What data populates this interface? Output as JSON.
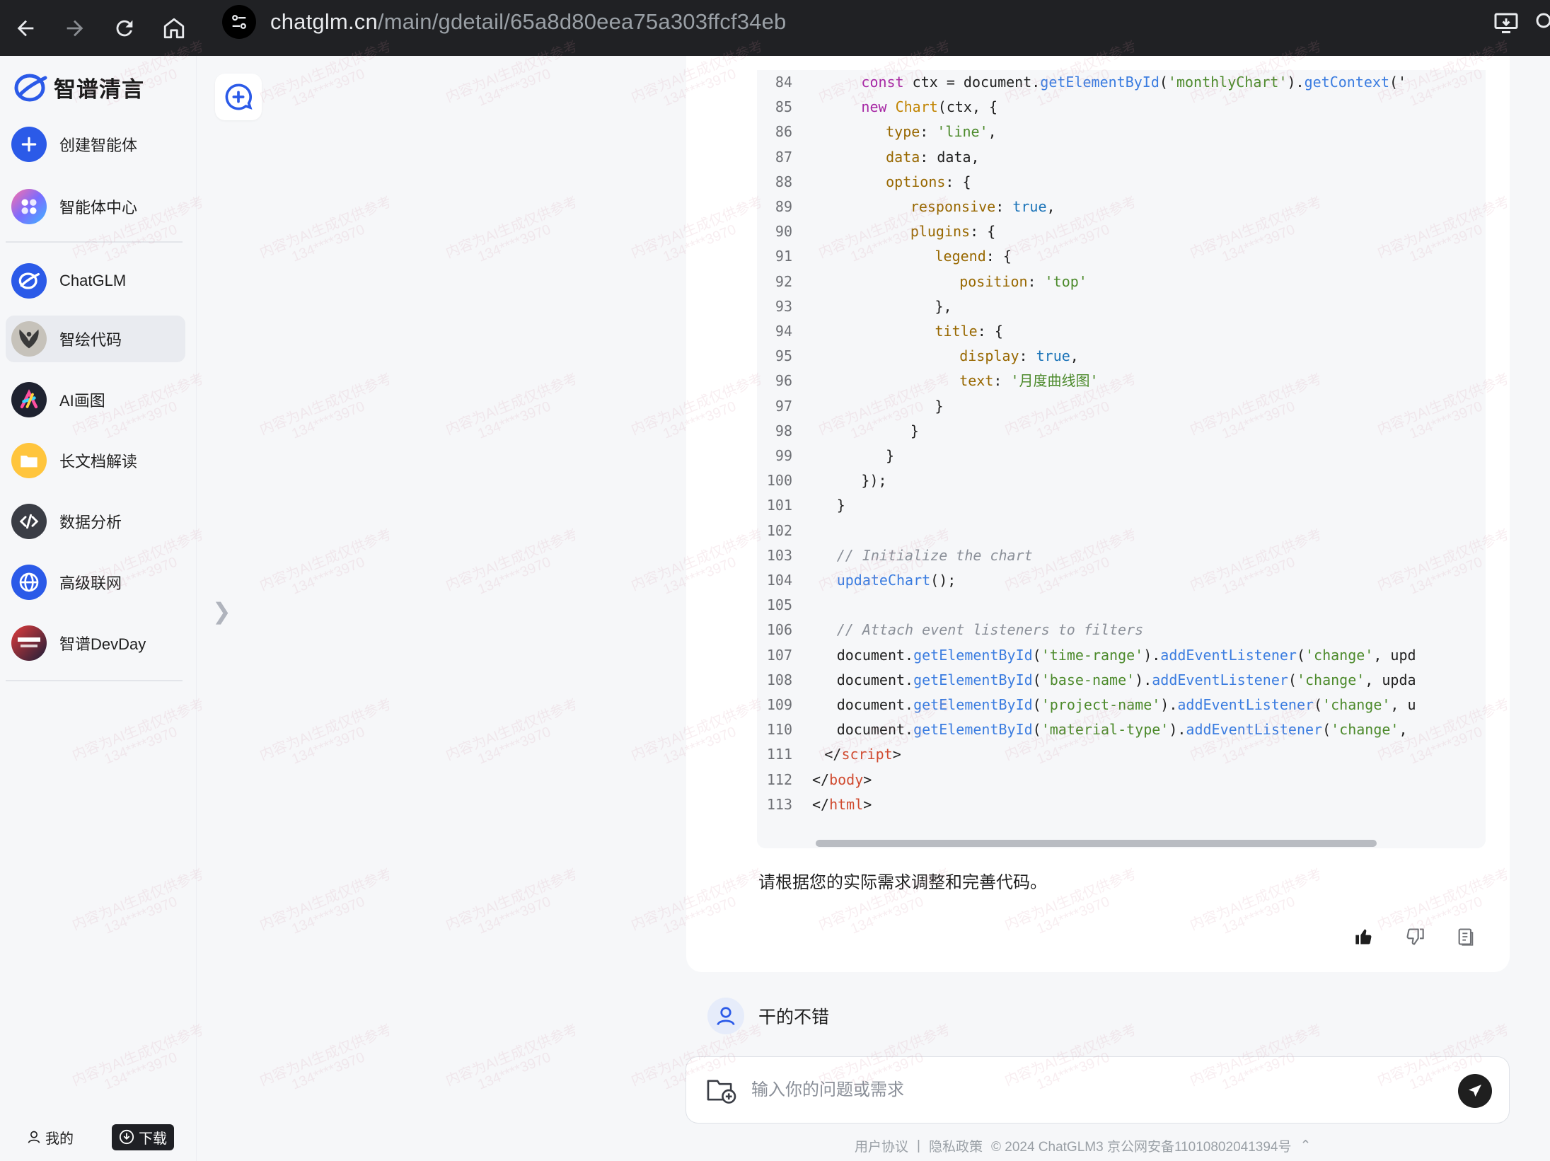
{
  "browser": {
    "url_host": "chatglm.cn",
    "url_path": "/main/gdetail/65a8d80eea75a303ffcf34eb"
  },
  "sidebar": {
    "logo_text": "智谱清言",
    "items": [
      {
        "label": "创建智能体",
        "icon": "plus-icon"
      },
      {
        "label": "智能体中心",
        "icon": "apps-icon"
      },
      {
        "label": "ChatGLM",
        "icon": "chatglm-logo-icon"
      },
      {
        "label": "智绘代码",
        "icon": "bird-avatar-icon",
        "active": true
      },
      {
        "label": "AI画图",
        "icon": "ai-draw-icon"
      },
      {
        "label": "长文档解读",
        "icon": "folder-icon"
      },
      {
        "label": "数据分析",
        "icon": "code-icon"
      },
      {
        "label": "高级联网",
        "icon": "globe-icon"
      },
      {
        "label": "智谱DevDay",
        "icon": "devday-icon"
      }
    ],
    "me_label": "我的",
    "download_label": "下载"
  },
  "code": {
    "lines": [
      {
        "n": "84",
        "indent": 8,
        "tokens": [
          [
            "kw",
            "const"
          ],
          [
            "pl",
            " ctx = "
          ],
          [
            "pl",
            "document."
          ],
          [
            "fn",
            "getElementById"
          ],
          [
            "pl",
            "("
          ],
          [
            "str",
            "'monthlyChart'"
          ],
          [
            "pl",
            ")."
          ],
          [
            "fn",
            "getContext"
          ],
          [
            "pl",
            "('"
          ]
        ]
      },
      {
        "n": "85",
        "indent": 8,
        "tokens": [
          [
            "kw",
            "new"
          ],
          [
            "pl",
            " "
          ],
          [
            "cls",
            "Chart"
          ],
          [
            "pl",
            "(ctx, {"
          ]
        ]
      },
      {
        "n": "86",
        "indent": 12,
        "tokens": [
          [
            "prop",
            "type"
          ],
          [
            "pl",
            ": "
          ],
          [
            "str",
            "'line'"
          ],
          [
            "pl",
            ","
          ]
        ]
      },
      {
        "n": "87",
        "indent": 12,
        "tokens": [
          [
            "prop",
            "data"
          ],
          [
            "pl",
            ": data,"
          ]
        ]
      },
      {
        "n": "88",
        "indent": 12,
        "tokens": [
          [
            "prop",
            "options"
          ],
          [
            "pl",
            ": {"
          ]
        ]
      },
      {
        "n": "89",
        "indent": 16,
        "tokens": [
          [
            "prop",
            "responsive"
          ],
          [
            "pl",
            ": "
          ],
          [
            "bool",
            "true"
          ],
          [
            "pl",
            ","
          ]
        ]
      },
      {
        "n": "90",
        "indent": 16,
        "tokens": [
          [
            "prop",
            "plugins"
          ],
          [
            "pl",
            ": {"
          ]
        ]
      },
      {
        "n": "91",
        "indent": 20,
        "tokens": [
          [
            "prop",
            "legend"
          ],
          [
            "pl",
            ": {"
          ]
        ]
      },
      {
        "n": "92",
        "indent": 24,
        "tokens": [
          [
            "prop",
            "position"
          ],
          [
            "pl",
            ": "
          ],
          [
            "str",
            "'top'"
          ]
        ]
      },
      {
        "n": "93",
        "indent": 20,
        "tokens": [
          [
            "pl",
            "},"
          ]
        ]
      },
      {
        "n": "94",
        "indent": 20,
        "tokens": [
          [
            "prop",
            "title"
          ],
          [
            "pl",
            ": {"
          ]
        ]
      },
      {
        "n": "95",
        "indent": 24,
        "tokens": [
          [
            "prop",
            "display"
          ],
          [
            "pl",
            ": "
          ],
          [
            "bool",
            "true"
          ],
          [
            "pl",
            ","
          ]
        ]
      },
      {
        "n": "96",
        "indent": 24,
        "tokens": [
          [
            "prop",
            "text"
          ],
          [
            "pl",
            ": "
          ],
          [
            "str",
            "'月度曲线图'"
          ]
        ]
      },
      {
        "n": "97",
        "indent": 20,
        "tokens": [
          [
            "pl",
            "}"
          ]
        ]
      },
      {
        "n": "98",
        "indent": 16,
        "tokens": [
          [
            "pl",
            "}"
          ]
        ]
      },
      {
        "n": "99",
        "indent": 12,
        "tokens": [
          [
            "pl",
            "}"
          ]
        ]
      },
      {
        "n": "100",
        "indent": 8,
        "tokens": [
          [
            "pl",
            "});"
          ]
        ]
      },
      {
        "n": "101",
        "indent": 4,
        "tokens": [
          [
            "pl",
            "}"
          ]
        ]
      },
      {
        "n": "102",
        "indent": 0,
        "tokens": []
      },
      {
        "n": "103",
        "indent": 4,
        "tokens": [
          [
            "cmt",
            "// Initialize the chart"
          ]
        ]
      },
      {
        "n": "104",
        "indent": 4,
        "tokens": [
          [
            "fn",
            "updateChart"
          ],
          [
            "pl",
            "();"
          ]
        ]
      },
      {
        "n": "105",
        "indent": 0,
        "tokens": []
      },
      {
        "n": "106",
        "indent": 4,
        "tokens": [
          [
            "cmt",
            "// Attach event listeners to filters"
          ]
        ]
      },
      {
        "n": "107",
        "indent": 4,
        "tokens": [
          [
            "pl",
            "document."
          ],
          [
            "fn",
            "getElementById"
          ],
          [
            "pl",
            "("
          ],
          [
            "str",
            "'time-range'"
          ],
          [
            "pl",
            ")."
          ],
          [
            "fn",
            "addEventListener"
          ],
          [
            "pl",
            "("
          ],
          [
            "str",
            "'change'"
          ],
          [
            "pl",
            ", upd"
          ]
        ]
      },
      {
        "n": "108",
        "indent": 4,
        "tokens": [
          [
            "pl",
            "document."
          ],
          [
            "fn",
            "getElementById"
          ],
          [
            "pl",
            "("
          ],
          [
            "str",
            "'base-name'"
          ],
          [
            "pl",
            ")."
          ],
          [
            "fn",
            "addEventListener"
          ],
          [
            "pl",
            "("
          ],
          [
            "str",
            "'change'"
          ],
          [
            "pl",
            ", upda"
          ]
        ]
      },
      {
        "n": "109",
        "indent": 4,
        "tokens": [
          [
            "pl",
            "document."
          ],
          [
            "fn",
            "getElementById"
          ],
          [
            "pl",
            "("
          ],
          [
            "str",
            "'project-name'"
          ],
          [
            "pl",
            ")."
          ],
          [
            "fn",
            "addEventListener"
          ],
          [
            "pl",
            "("
          ],
          [
            "str",
            "'change'"
          ],
          [
            "pl",
            ", u"
          ]
        ]
      },
      {
        "n": "110",
        "indent": 4,
        "tokens": [
          [
            "pl",
            "document."
          ],
          [
            "fn",
            "getElementById"
          ],
          [
            "pl",
            "("
          ],
          [
            "str",
            "'material-type'"
          ],
          [
            "pl",
            ")."
          ],
          [
            "fn",
            "addEventListener"
          ],
          [
            "pl",
            "("
          ],
          [
            "str",
            "'change'"
          ],
          [
            "pl",
            ","
          ]
        ]
      },
      {
        "n": "111",
        "indent": 2,
        "tokens": [
          [
            "pl",
            "</"
          ],
          [
            "tag",
            "script"
          ],
          [
            "pl",
            ">"
          ]
        ]
      },
      {
        "n": "112",
        "indent": 0,
        "tokens": [
          [
            "pl",
            "</"
          ],
          [
            "tag",
            "body"
          ],
          [
            "pl",
            ">"
          ]
        ]
      },
      {
        "n": "113",
        "indent": 0,
        "tokens": [
          [
            "pl",
            "</"
          ],
          [
            "tag",
            "html"
          ],
          [
            "pl",
            ">"
          ]
        ]
      }
    ]
  },
  "answer": {
    "text": "请根据您的实际需求调整和完善代码。"
  },
  "user_message": {
    "text": "干的不错"
  },
  "input": {
    "placeholder": "输入你的问题或需求"
  },
  "footer": {
    "agreement": "用户协议",
    "privacy": "隐私政策",
    "copyright": "© 2024 ChatGLM3 京公网安备11010802041394号",
    "sep": "|"
  },
  "watermark": {
    "line1": "内容为AI生成仅供参考",
    "line2": "134****3970"
  },
  "colors": {
    "accent": "#2b5ae8",
    "chrome_bg": "#202124",
    "page_bg": "#f6f7f9"
  }
}
